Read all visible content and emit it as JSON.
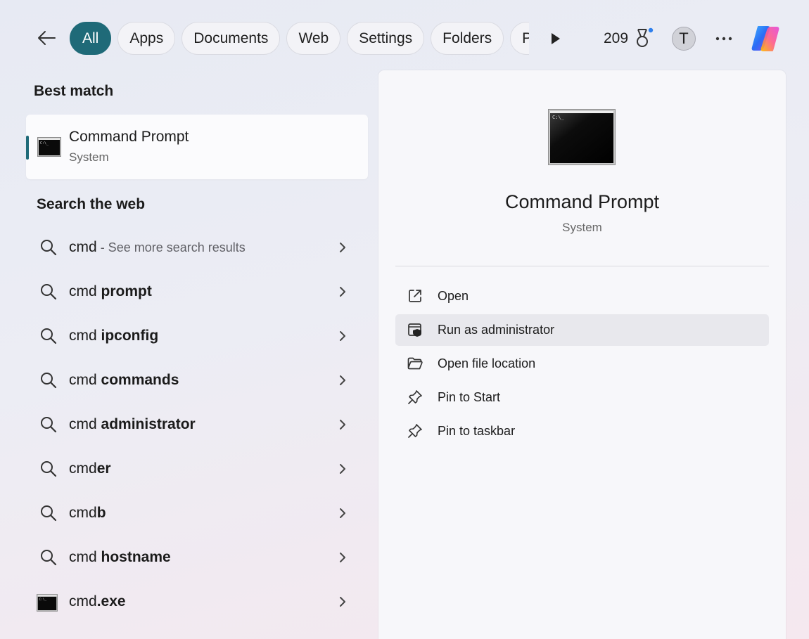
{
  "topbar": {
    "filters": [
      {
        "label": "All",
        "active": true
      },
      {
        "label": "Apps",
        "active": false
      },
      {
        "label": "Documents",
        "active": false
      },
      {
        "label": "Web",
        "active": false
      },
      {
        "label": "Settings",
        "active": false
      },
      {
        "label": "Folders",
        "active": false
      },
      {
        "label": "Ph",
        "active": false
      }
    ],
    "points": "209",
    "avatar_initial": "T",
    "accent_color": "#1f6a78"
  },
  "best_match": {
    "heading": "Best match",
    "name": "Command Prompt",
    "type": "System",
    "icon": "command-prompt-icon"
  },
  "web": {
    "heading": "Search the web",
    "results": [
      {
        "prefix": "cmd",
        "bold": "",
        "more": " - See more search results",
        "icon": "search-icon"
      },
      {
        "prefix": "cmd ",
        "bold": "prompt",
        "more": "",
        "icon": "search-icon"
      },
      {
        "prefix": "cmd ",
        "bold": "ipconfig",
        "more": "",
        "icon": "search-icon"
      },
      {
        "prefix": "cmd ",
        "bold": "commands",
        "more": "",
        "icon": "search-icon"
      },
      {
        "prefix": "cmd ",
        "bold": "administrator",
        "more": "",
        "icon": "search-icon"
      },
      {
        "prefix": "cmd",
        "bold": "er",
        "more": "",
        "icon": "search-icon"
      },
      {
        "prefix": "cmd",
        "bold": "b",
        "more": "",
        "icon": "search-icon"
      },
      {
        "prefix": "cmd ",
        "bold": "hostname",
        "more": "",
        "icon": "search-icon"
      },
      {
        "prefix": "cmd",
        "bold": ".exe",
        "more": "",
        "icon": "command-prompt-icon"
      }
    ]
  },
  "detail": {
    "title": "Command Prompt",
    "subtitle": "System",
    "actions": [
      {
        "label": "Open",
        "icon": "open-external-icon"
      },
      {
        "label": "Run as administrator",
        "icon": "admin-shield-icon"
      },
      {
        "label": "Open file location",
        "icon": "folder-icon"
      },
      {
        "label": "Pin to Start",
        "icon": "pin-icon"
      },
      {
        "label": "Pin to taskbar",
        "icon": "pin-icon"
      }
    ]
  }
}
